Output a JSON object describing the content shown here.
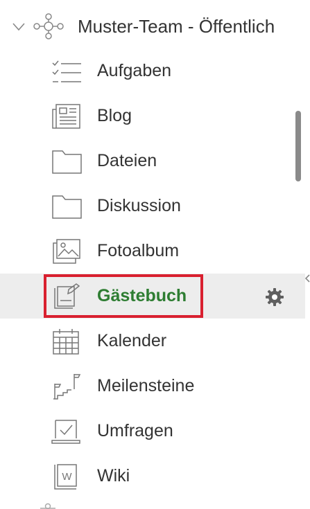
{
  "tree": {
    "team_label": "Muster-Team - Öffentlich",
    "items": [
      {
        "label": "Aufgaben",
        "icon": "tasks-icon"
      },
      {
        "label": "Blog",
        "icon": "newspaper-icon"
      },
      {
        "label": "Dateien",
        "icon": "folder-icon"
      },
      {
        "label": "Diskussion",
        "icon": "folder-icon"
      },
      {
        "label": "Fotoalbum",
        "icon": "photo-album-icon"
      },
      {
        "label": "Gästebuch",
        "icon": "guestbook-icon",
        "active": true
      },
      {
        "label": "Kalender",
        "icon": "calendar-icon"
      },
      {
        "label": "Meilensteine",
        "icon": "milestones-icon"
      },
      {
        "label": "Umfragen",
        "icon": "poll-icon"
      },
      {
        "label": "Wiki",
        "icon": "wiki-icon"
      }
    ]
  },
  "wiki_icon_letter": "W",
  "colors": {
    "active_text": "#2e7d32",
    "highlight_border": "#d9202f",
    "active_background": "#ededed",
    "icon_gray": "#777777"
  }
}
